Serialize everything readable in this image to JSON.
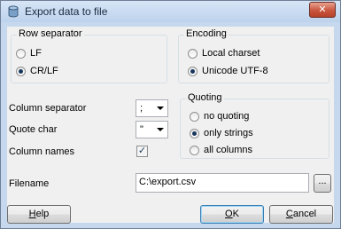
{
  "window": {
    "title": "Export data to file",
    "close_glyph": "✕",
    "icon": "database-icon"
  },
  "row_separator": {
    "label": "Row separator",
    "options": [
      {
        "label": "LF",
        "checked": false
      },
      {
        "label": "CR/LF",
        "checked": true
      }
    ]
  },
  "encoding": {
    "label": "Encoding",
    "options": [
      {
        "label": "Local charset",
        "checked": false
      },
      {
        "label": "Unicode UTF-8",
        "checked": true
      }
    ]
  },
  "column_separator": {
    "label": "Column separator",
    "value": ";"
  },
  "quote_char": {
    "label": "Quote char",
    "value": "\""
  },
  "column_names": {
    "label": "Column names",
    "checked": true,
    "glyph": "✓"
  },
  "quoting": {
    "label": "Quoting",
    "options": [
      {
        "label": "no quoting",
        "checked": false
      },
      {
        "label": "only strings",
        "checked": true
      },
      {
        "label": "all columns",
        "checked": false
      }
    ]
  },
  "filename": {
    "label": "Filename",
    "value": "C:\\export.csv",
    "browse_label": "..."
  },
  "buttons": {
    "help": {
      "mnemonic": "H",
      "rest": "elp"
    },
    "ok": {
      "mnemonic": "O",
      "rest": "K"
    },
    "cancel": {
      "mnemonic": "C",
      "rest": "ancel"
    }
  }
}
